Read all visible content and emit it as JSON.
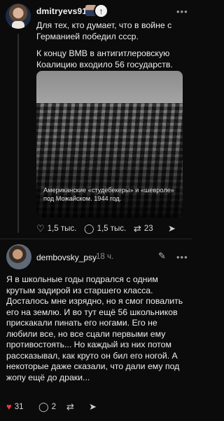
{
  "post1": {
    "username": "dmitryevs91",
    "text_lines": [
      "Для тех, кто думает, что в войне с Германией победил ссср.",
      "К концу ВМВ в антигитлеровскую Коалицию входило 56 государств."
    ],
    "photo_caption": "Американские «студебекеры» и «шевроле» под Можайском. 1944 год.",
    "likes": "1,5 тыс.",
    "comments": "1,5 тыс.",
    "reposts": "23"
  },
  "post2": {
    "username": "dembovsky_psy",
    "time": "18 ч.",
    "text": "Я в школьные годы подрался с одним крутым задирой из старшего класса. Досталось мне изрядно, но я смог повалить его на землю. И во тут ещё 56 школьников прискакали пинать его ногами. Его не любили все, но все сцали первыми ему противостоять... Но каждый из них потом рассказывал, как круто он бил его ногой. А некоторые даже сказали, что дали ему под жопу ещё до драки...",
    "likes": "31",
    "comments": "2"
  },
  "colors": {
    "background": "#0b0b0b",
    "like_active": "#ff3040"
  },
  "icons": [
    "follow-plus-icon",
    "more-icon",
    "heart-icon",
    "comment-icon",
    "repost-icon",
    "share-icon",
    "edit-icon"
  ]
}
